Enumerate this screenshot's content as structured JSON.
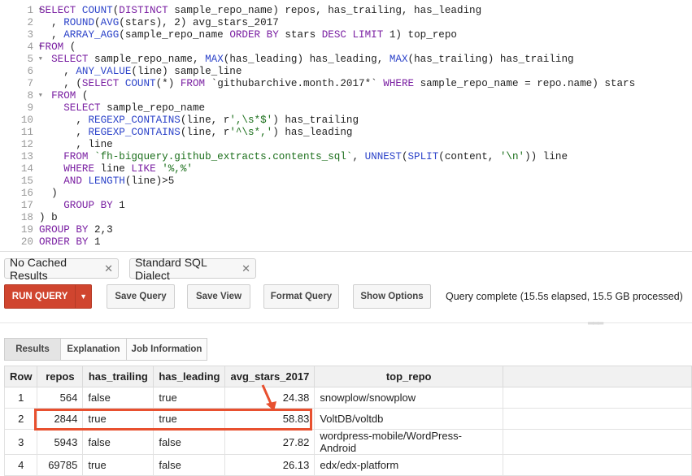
{
  "editor": {
    "line_numbers": [
      "1",
      "2",
      "3",
      "4",
      "5",
      "6",
      "7",
      "8",
      "9",
      "10",
      "11",
      "12",
      "13",
      "14",
      "15",
      "16",
      "17",
      "18",
      "19",
      "20"
    ],
    "lines": [
      [
        [
          "SELECT ",
          "kw"
        ],
        [
          "COUNT",
          "fn"
        ],
        [
          "(",
          ""
        ],
        [
          "DISTINCT ",
          "kw"
        ],
        [
          "sample_repo_name) repos, has_trailing, has_leading",
          ""
        ]
      ],
      [
        [
          "  , ",
          ""
        ],
        [
          "ROUND",
          "fn"
        ],
        [
          "(",
          ""
        ],
        [
          "AVG",
          "fn"
        ],
        [
          "(stars), 2) avg_stars_2017",
          ""
        ]
      ],
      [
        [
          "  , ",
          ""
        ],
        [
          "ARRAY_AGG",
          "fn"
        ],
        [
          "(sample_repo_name ",
          ""
        ],
        [
          "ORDER BY ",
          "kw"
        ],
        [
          "stars ",
          ""
        ],
        [
          "DESC LIMIT ",
          "kw"
        ],
        [
          "1) top_repo",
          ""
        ]
      ],
      [
        [
          "FROM ",
          "kw"
        ],
        [
          "(",
          ""
        ]
      ],
      [
        [
          "  ",
          ""
        ],
        [
          "SELECT ",
          "kw"
        ],
        [
          "sample_repo_name, ",
          ""
        ],
        [
          "MAX",
          "fn"
        ],
        [
          "(has_leading) has_leading, ",
          ""
        ],
        [
          "MAX",
          "fn"
        ],
        [
          "(has_trailing) has_trailing",
          ""
        ]
      ],
      [
        [
          "    , ",
          ""
        ],
        [
          "ANY_VALUE",
          "fn"
        ],
        [
          "(line) sample_line",
          ""
        ]
      ],
      [
        [
          "    , (",
          ""
        ],
        [
          "SELECT ",
          "kw"
        ],
        [
          "COUNT",
          "fn"
        ],
        [
          "(*) ",
          ""
        ],
        [
          "FROM ",
          "kw"
        ],
        [
          "`githubarchive.month.2017*` ",
          ""
        ],
        [
          "WHERE ",
          "kw"
        ],
        [
          "sample_repo_name = repo.name) stars",
          ""
        ]
      ],
      [
        [
          "  ",
          ""
        ],
        [
          "FROM ",
          "kw"
        ],
        [
          "(",
          ""
        ]
      ],
      [
        [
          "    ",
          ""
        ],
        [
          "SELECT ",
          "kw"
        ],
        [
          "sample_repo_name",
          ""
        ]
      ],
      [
        [
          "      , ",
          ""
        ],
        [
          "REGEXP_CONTAINS",
          "fn"
        ],
        [
          "(line, r",
          ""
        ],
        [
          "',\\s*$'",
          "str"
        ],
        [
          ") has_trailing",
          ""
        ]
      ],
      [
        [
          "      , ",
          ""
        ],
        [
          "REGEXP_CONTAINS",
          "fn"
        ],
        [
          "(line, r",
          ""
        ],
        [
          "'^\\s*,'",
          "str"
        ],
        [
          ") has_leading",
          ""
        ]
      ],
      [
        [
          "      , line",
          ""
        ]
      ],
      [
        [
          "    ",
          ""
        ],
        [
          "FROM ",
          "kw"
        ],
        [
          "`fh-bigquery.github_extracts.contents_sql`",
          "str"
        ],
        [
          ", ",
          ""
        ],
        [
          "UNNEST",
          "fn"
        ],
        [
          "(",
          ""
        ],
        [
          "SPLIT",
          "fn"
        ],
        [
          "(content, ",
          ""
        ],
        [
          "'\\n'",
          "str"
        ],
        [
          ")) line",
          ""
        ]
      ],
      [
        [
          "    ",
          ""
        ],
        [
          "WHERE ",
          "kw"
        ],
        [
          "line ",
          ""
        ],
        [
          "LIKE ",
          "kw"
        ],
        [
          "'%,%'",
          "str"
        ]
      ],
      [
        [
          "    ",
          ""
        ],
        [
          "AND ",
          "kw"
        ],
        [
          "LENGTH",
          "fn"
        ],
        [
          "(line)>5",
          ""
        ]
      ],
      [
        [
          "  )",
          ""
        ]
      ],
      [
        [
          "    ",
          ""
        ],
        [
          "GROUP BY ",
          "kw"
        ],
        [
          "1",
          ""
        ]
      ],
      [
        [
          ") b",
          ""
        ]
      ],
      [
        [
          "GROUP BY ",
          "kw"
        ],
        [
          "2,3",
          ""
        ]
      ],
      [
        [
          "ORDER BY ",
          "kw"
        ],
        [
          "1",
          ""
        ]
      ]
    ]
  },
  "options": {
    "cached_label": "No Cached Results",
    "dialect_label": "Standard SQL Dialect",
    "remove_glyph": "✕"
  },
  "toolbar": {
    "run_label": "RUN QUERY",
    "save_query_label": "Save Query",
    "save_view_label": "Save View",
    "format_query_label": "Format Query",
    "show_options_label": "Show Options",
    "status": "Query complete (15.5s elapsed, 15.5 GB processed)"
  },
  "tabs": [
    "Results",
    "Explanation",
    "Job Information"
  ],
  "results": {
    "columns": [
      "Row",
      "repos",
      "has_trailing",
      "has_leading",
      "avg_stars_2017",
      "top_repo"
    ],
    "rows": [
      [
        "1",
        "564",
        "false",
        "true",
        "24.38",
        "snowplow/snowplow"
      ],
      [
        "2",
        "2844",
        "true",
        "true",
        "58.83",
        "VoltDB/voltdb"
      ],
      [
        "3",
        "5943",
        "false",
        "false",
        "27.82",
        "wordpress-mobile/WordPress-Android"
      ],
      [
        "4",
        "69785",
        "true",
        "false",
        "26.13",
        "edx/edx-platform"
      ]
    ]
  },
  "colors": {
    "run_button": "#d0452f",
    "annotation": "#e8502f"
  }
}
